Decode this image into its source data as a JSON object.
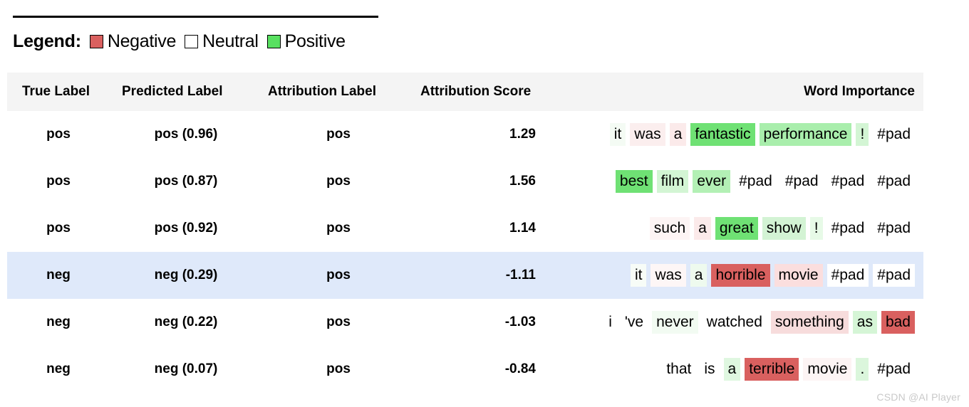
{
  "legend": {
    "title": "Legend:",
    "items": [
      {
        "label": "Negative",
        "color": "#d9605f",
        "swatch_name": "legend-swatch-negative"
      },
      {
        "label": "Neutral",
        "color": "#ffffff",
        "swatch_name": "legend-swatch-neutral"
      },
      {
        "label": "Positive",
        "color": "#58e060",
        "swatch_name": "legend-swatch-positive"
      }
    ]
  },
  "table": {
    "columns": [
      "True Label",
      "Predicted Label",
      "Attribution Label",
      "Attribution Score",
      "Word Importance"
    ],
    "rows": [
      {
        "true_label": "pos",
        "predicted_label": "pos (0.96)",
        "attribution_label": "pos",
        "attribution_score": "1.29",
        "highlighted": false,
        "tokens": [
          {
            "text": "it",
            "color": "#f4fbf4"
          },
          {
            "text": "was",
            "color": "#fbeeee"
          },
          {
            "text": "a",
            "color": "#fbeaea"
          },
          {
            "text": "fantastic",
            "color": "#6fe174"
          },
          {
            "text": "performance",
            "color": "#a9eeac"
          },
          {
            "text": "!",
            "color": "#d3f5d4"
          },
          {
            "text": "#pad",
            "color": "#ffffff"
          }
        ]
      },
      {
        "true_label": "pos",
        "predicted_label": "pos (0.87)",
        "attribution_label": "pos",
        "attribution_score": "1.56",
        "highlighted": false,
        "tokens": [
          {
            "text": "best",
            "color": "#6fe174"
          },
          {
            "text": "film",
            "color": "#d3f5d4"
          },
          {
            "text": "ever",
            "color": "#b3f0b5"
          },
          {
            "text": "#pad",
            "color": "#ffffff"
          },
          {
            "text": "#pad",
            "color": "#ffffff"
          },
          {
            "text": "#pad",
            "color": "#ffffff"
          },
          {
            "text": "#pad",
            "color": "#ffffff"
          }
        ]
      },
      {
        "true_label": "pos",
        "predicted_label": "pos (0.92)",
        "attribution_label": "pos",
        "attribution_score": "1.14",
        "highlighted": false,
        "tokens": [
          {
            "text": "such",
            "color": "#fdf4f4"
          },
          {
            "text": "a",
            "color": "#fbeaea"
          },
          {
            "text": "great",
            "color": "#6fe174"
          },
          {
            "text": "show",
            "color": "#d3f3d4"
          },
          {
            "text": "!",
            "color": "#e7faE7"
          },
          {
            "text": "#pad",
            "color": "#ffffff"
          },
          {
            "text": "#pad",
            "color": "#ffffff"
          }
        ]
      },
      {
        "true_label": "neg",
        "predicted_label": "neg (0.29)",
        "attribution_label": "pos",
        "attribution_score": "-1.11",
        "highlighted": true,
        "tokens": [
          {
            "text": "it",
            "color": "#f7fcf7"
          },
          {
            "text": "was",
            "color": "#fdf6f6"
          },
          {
            "text": "a",
            "color": "#eefaee"
          },
          {
            "text": "horrible",
            "color": "#d9605f"
          },
          {
            "text": "movie",
            "color": "#fbdede"
          },
          {
            "text": "#pad",
            "color": "#ffffff"
          },
          {
            "text": "#pad",
            "color": "#ffffff"
          }
        ]
      },
      {
        "true_label": "neg",
        "predicted_label": "neg (0.22)",
        "attribution_label": "pos",
        "attribution_score": "-1.03",
        "highlighted": false,
        "tokens": [
          {
            "text": "i",
            "color": "#ffffff"
          },
          {
            "text": "'ve",
            "color": "#ffffff"
          },
          {
            "text": "never",
            "color": "#f2fbf2"
          },
          {
            "text": "watched",
            "color": "#ffffff"
          },
          {
            "text": "something",
            "color": "#f7dcdc"
          },
          {
            "text": "as",
            "color": "#d5f5d6"
          },
          {
            "text": "bad",
            "color": "#d9605f"
          }
        ]
      },
      {
        "true_label": "neg",
        "predicted_label": "neg (0.07)",
        "attribution_label": "pos",
        "attribution_score": "-0.84",
        "highlighted": false,
        "tokens": [
          {
            "text": "that",
            "color": "#ffffff"
          },
          {
            "text": "is",
            "color": "#ffffff"
          },
          {
            "text": "a",
            "color": "#dff7e0"
          },
          {
            "text": "terrible",
            "color": "#d9605f"
          },
          {
            "text": "movie",
            "color": "#fdf4f4"
          },
          {
            "text": ".",
            "color": "#dbf6dc"
          },
          {
            "text": "#pad",
            "color": "#ffffff"
          }
        ]
      }
    ]
  },
  "watermark": "CSDN @AI Player"
}
